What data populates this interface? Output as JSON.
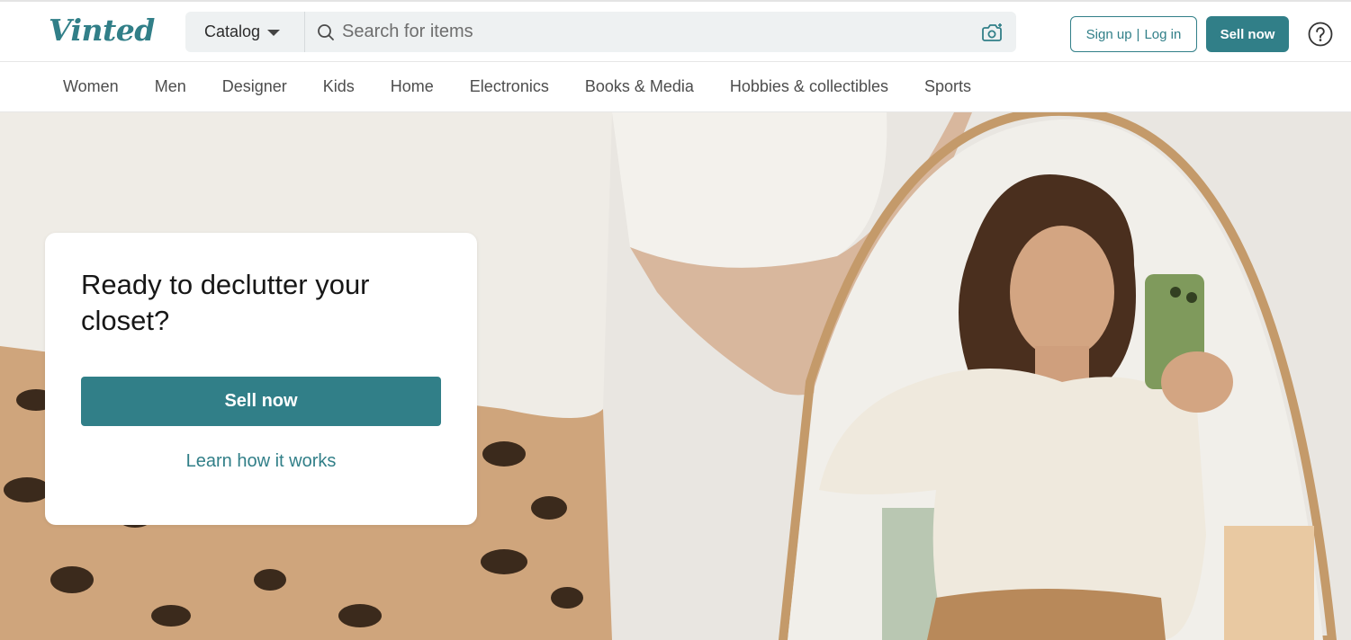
{
  "brand": {
    "logo_text": "Vinted",
    "accent": "#317f88"
  },
  "header": {
    "catalog_label": "Catalog",
    "search_placeholder": "Search for items",
    "signup_label": "Sign up",
    "login_label": "Log in",
    "login_separator": "|",
    "sell_now_label": "Sell now",
    "icons": [
      "search-icon",
      "camera-icon",
      "help-icon",
      "chevron-down-icon"
    ]
  },
  "nav": {
    "items": [
      "Women",
      "Men",
      "Designer",
      "Kids",
      "Home",
      "Electronics",
      "Books & Media",
      "Hobbies & collectibles",
      "Sports"
    ]
  },
  "hero": {
    "title": "Ready to declutter your closet?",
    "cta_label": "Sell now",
    "link_label": "Learn how it works"
  }
}
